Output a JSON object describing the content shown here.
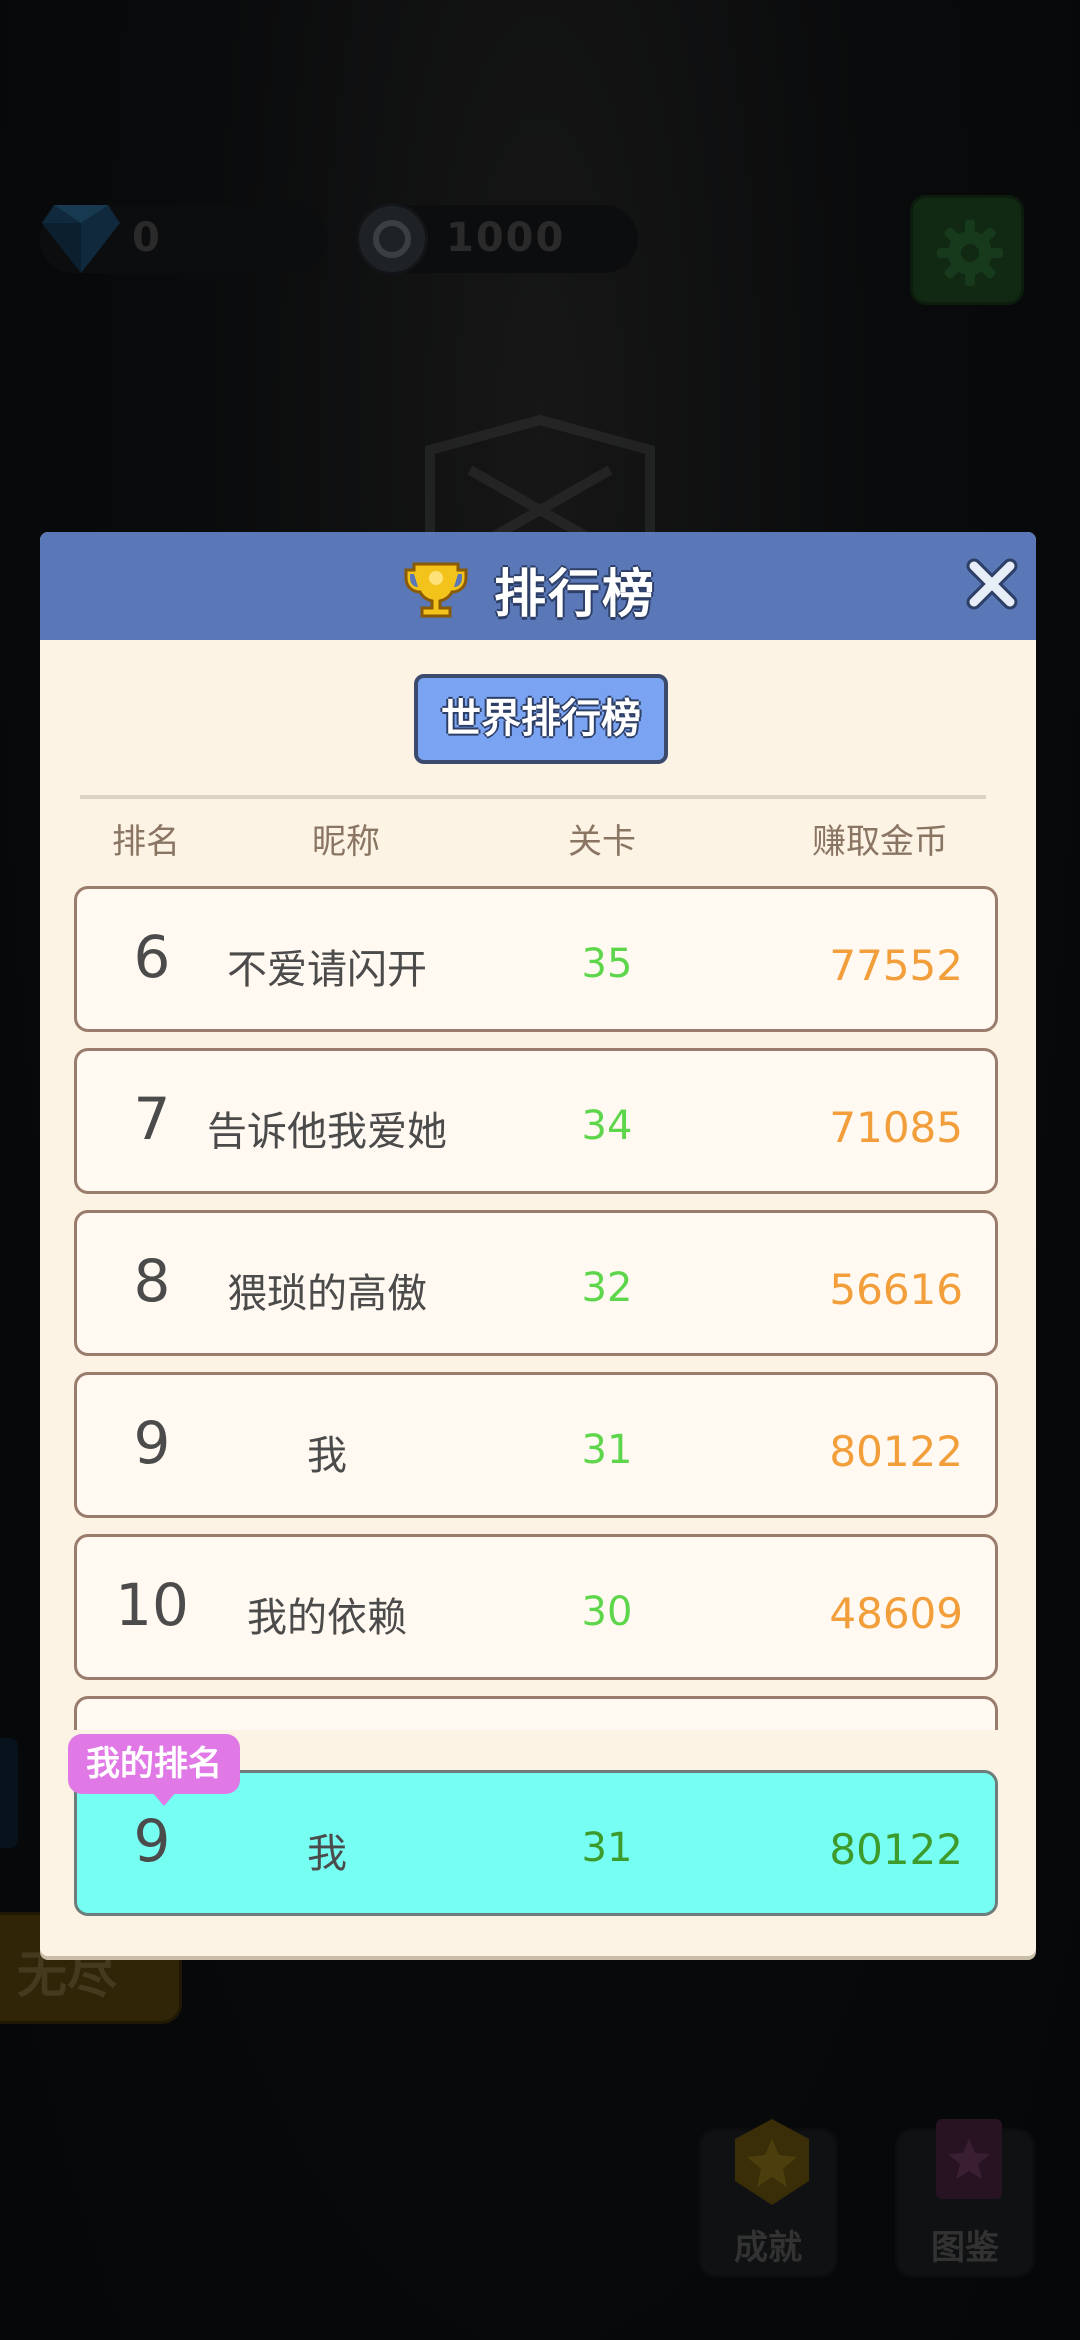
{
  "top_bar": {
    "gems": "0",
    "coins": "1000",
    "gem_icon": "diamond-icon",
    "coin_icon": "coin-icon",
    "settings_icon": "gear-icon"
  },
  "background_buttons": {
    "endless_label": "无尽",
    "achievements_label": "成就",
    "collection_label": "图鉴"
  },
  "leaderboard": {
    "title": "排行榜",
    "title_icon": "trophy-icon",
    "close_icon": "close-icon",
    "tab_world": "世界排行榜",
    "columns": {
      "rank": "排名",
      "name": "昵称",
      "level": "关卡",
      "coins": "赚取金币"
    },
    "rows": [
      {
        "rank": "6",
        "name": "不爱请闪开",
        "level": "35",
        "coins": "77552"
      },
      {
        "rank": "7",
        "name": "告诉他我爱她",
        "level": "34",
        "coins": "71085"
      },
      {
        "rank": "8",
        "name": "猥琐的高傲",
        "level": "32",
        "coins": "56616"
      },
      {
        "rank": "9",
        "name": "我",
        "level": "31",
        "coins": "80122"
      },
      {
        "rank": "10",
        "name": "我的依赖",
        "level": "30",
        "coins": "48609"
      },
      {
        "rank": "",
        "name": "",
        "level": "",
        "coins": ""
      }
    ],
    "my_rank_label": "我的排名",
    "my_row": {
      "rank": "9",
      "name": "我",
      "level": "31",
      "coins": "80122"
    }
  },
  "colors": {
    "header": "#5a77b8",
    "level_green": "#5ed64b",
    "coins_orange": "#f29e3a",
    "my_row_bg": "#76fef3",
    "badge_pink": "#e078e6"
  }
}
